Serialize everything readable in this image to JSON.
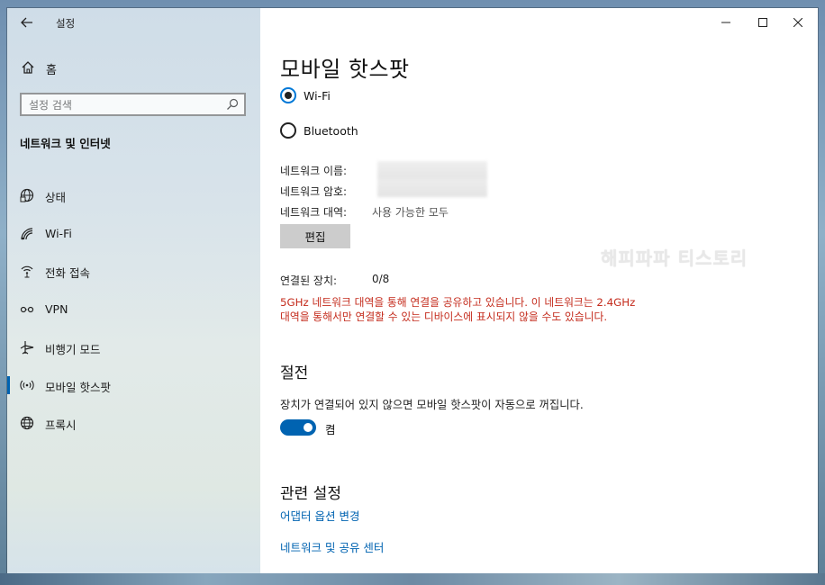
{
  "app": {
    "title": "설정",
    "back_icon": "back-arrow-icon",
    "home_label": "홈",
    "search_placeholder": "설정 검색",
    "section_title": "네트워크 및 인터넷"
  },
  "sidebar": {
    "items": [
      {
        "label": "상태",
        "icon": "globe-status-icon",
        "active": false
      },
      {
        "label": "Wi-Fi",
        "icon": "wifi-icon",
        "active": false
      },
      {
        "label": "전화 접속",
        "icon": "dialup-icon",
        "active": false
      },
      {
        "label": "VPN",
        "icon": "vpn-icon",
        "active": false
      },
      {
        "label": "비행기 모드",
        "icon": "airplane-icon",
        "active": false
      },
      {
        "label": "모바일 핫스팟",
        "icon": "hotspot-icon",
        "active": true
      },
      {
        "label": "프록시",
        "icon": "globe-icon",
        "active": false
      }
    ]
  },
  "window_controls": [
    "minimize",
    "maximize",
    "close"
  ],
  "main": {
    "title": "모바일 핫스팟",
    "share_options": [
      {
        "label": "Wi-Fi",
        "checked": true
      },
      {
        "label": "Bluetooth",
        "checked": false
      }
    ],
    "network_name_label": "네트워크 이름:",
    "network_password_label": "네트워크 암호:",
    "network_band_label": "네트워크 대역:",
    "network_band_value": "사용 가능한 모두",
    "edit_button": "편집",
    "connected_label": "연결된 장치:",
    "connected_value": "0/8",
    "warning_text": "5GHz 네트워크 대역을 통해 연결을 공유하고 있습니다. 이 네트워크는 2.4GHz 대역을 통해서만 연결할 수 있는 디바이스에 표시되지 않을 수도 있습니다.",
    "watermark": "해피파파 티스토리",
    "power_heading": "절전",
    "power_desc": "장치가 연결되어 있지 않으면 모바일 핫스팟이 자동으로 꺼집니다.",
    "power_toggle_on": true,
    "power_toggle_label": "켬",
    "related_heading": "관련 설정",
    "related_links": [
      "어댑터 옵션 변경",
      "네트워크 및 공유 센터"
    ]
  },
  "colors": {
    "accent": "#0063b1",
    "warning": "#c42b1c"
  }
}
